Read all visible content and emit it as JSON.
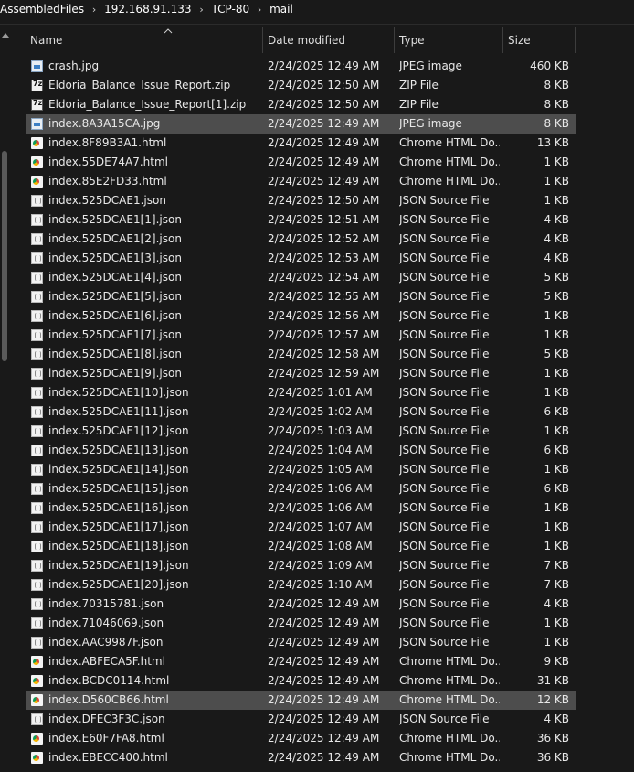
{
  "breadcrumb": {
    "items": [
      "AssembledFiles",
      "192.168.91.133",
      "TCP-80",
      "mail"
    ],
    "separator": "›"
  },
  "columns": {
    "name": "Name",
    "date": "Date modified",
    "type": "Type",
    "size": "Size",
    "sorted_column": "Name",
    "sort_direction": "ascending"
  },
  "files": [
    {
      "name": "crash.jpg",
      "date": "2/24/2025 12:49 AM",
      "type": "JPEG image",
      "size": "460 KB",
      "icon": "jpg-image-icon",
      "selected": false
    },
    {
      "name": "Eldoria_Balance_Issue_Report.zip",
      "date": "2/24/2025 12:50 AM",
      "type": "ZIP File",
      "size": "8 KB",
      "icon": "7zip-archive-icon",
      "selected": false
    },
    {
      "name": "Eldoria_Balance_Issue_Report[1].zip",
      "date": "2/24/2025 12:50 AM",
      "type": "ZIP File",
      "size": "8 KB",
      "icon": "7zip-archive-icon",
      "selected": false
    },
    {
      "name": "index.8A3A15CA.jpg",
      "date": "2/24/2025 12:49 AM",
      "type": "JPEG image",
      "size": "8 KB",
      "icon": "jpg-image-icon",
      "selected": true
    },
    {
      "name": "index.8F89B3A1.html",
      "date": "2/24/2025 12:49 AM",
      "type": "Chrome HTML Do...",
      "size": "13 KB",
      "icon": "chrome-html-icon",
      "selected": false
    },
    {
      "name": "index.55DE74A7.html",
      "date": "2/24/2025 12:49 AM",
      "type": "Chrome HTML Do...",
      "size": "1 KB",
      "icon": "chrome-html-icon",
      "selected": false
    },
    {
      "name": "index.85E2FD33.html",
      "date": "2/24/2025 12:49 AM",
      "type": "Chrome HTML Do...",
      "size": "1 KB",
      "icon": "chrome-html-icon",
      "selected": false
    },
    {
      "name": "index.525DCAE1.json",
      "date": "2/24/2025 12:50 AM",
      "type": "JSON Source File",
      "size": "1 KB",
      "icon": "json-file-icon",
      "selected": false
    },
    {
      "name": "index.525DCAE1[1].json",
      "date": "2/24/2025 12:51 AM",
      "type": "JSON Source File",
      "size": "4 KB",
      "icon": "json-file-icon",
      "selected": false
    },
    {
      "name": "index.525DCAE1[2].json",
      "date": "2/24/2025 12:52 AM",
      "type": "JSON Source File",
      "size": "4 KB",
      "icon": "json-file-icon",
      "selected": false
    },
    {
      "name": "index.525DCAE1[3].json",
      "date": "2/24/2025 12:53 AM",
      "type": "JSON Source File",
      "size": "4 KB",
      "icon": "json-file-icon",
      "selected": false
    },
    {
      "name": "index.525DCAE1[4].json",
      "date": "2/24/2025 12:54 AM",
      "type": "JSON Source File",
      "size": "5 KB",
      "icon": "json-file-icon",
      "selected": false
    },
    {
      "name": "index.525DCAE1[5].json",
      "date": "2/24/2025 12:55 AM",
      "type": "JSON Source File",
      "size": "5 KB",
      "icon": "json-file-icon",
      "selected": false
    },
    {
      "name": "index.525DCAE1[6].json",
      "date": "2/24/2025 12:56 AM",
      "type": "JSON Source File",
      "size": "1 KB",
      "icon": "json-file-icon",
      "selected": false
    },
    {
      "name": "index.525DCAE1[7].json",
      "date": "2/24/2025 12:57 AM",
      "type": "JSON Source File",
      "size": "1 KB",
      "icon": "json-file-icon",
      "selected": false
    },
    {
      "name": "index.525DCAE1[8].json",
      "date": "2/24/2025 12:58 AM",
      "type": "JSON Source File",
      "size": "5 KB",
      "icon": "json-file-icon",
      "selected": false
    },
    {
      "name": "index.525DCAE1[9].json",
      "date": "2/24/2025 12:59 AM",
      "type": "JSON Source File",
      "size": "1 KB",
      "icon": "json-file-icon",
      "selected": false
    },
    {
      "name": "index.525DCAE1[10].json",
      "date": "2/24/2025 1:01 AM",
      "type": "JSON Source File",
      "size": "1 KB",
      "icon": "json-file-icon",
      "selected": false
    },
    {
      "name": "index.525DCAE1[11].json",
      "date": "2/24/2025 1:02 AM",
      "type": "JSON Source File",
      "size": "6 KB",
      "icon": "json-file-icon",
      "selected": false
    },
    {
      "name": "index.525DCAE1[12].json",
      "date": "2/24/2025 1:03 AM",
      "type": "JSON Source File",
      "size": "1 KB",
      "icon": "json-file-icon",
      "selected": false
    },
    {
      "name": "index.525DCAE1[13].json",
      "date": "2/24/2025 1:04 AM",
      "type": "JSON Source File",
      "size": "6 KB",
      "icon": "json-file-icon",
      "selected": false
    },
    {
      "name": "index.525DCAE1[14].json",
      "date": "2/24/2025 1:05 AM",
      "type": "JSON Source File",
      "size": "1 KB",
      "icon": "json-file-icon",
      "selected": false
    },
    {
      "name": "index.525DCAE1[15].json",
      "date": "2/24/2025 1:06 AM",
      "type": "JSON Source File",
      "size": "6 KB",
      "icon": "json-file-icon",
      "selected": false
    },
    {
      "name": "index.525DCAE1[16].json",
      "date": "2/24/2025 1:06 AM",
      "type": "JSON Source File",
      "size": "1 KB",
      "icon": "json-file-icon",
      "selected": false
    },
    {
      "name": "index.525DCAE1[17].json",
      "date": "2/24/2025 1:07 AM",
      "type": "JSON Source File",
      "size": "1 KB",
      "icon": "json-file-icon",
      "selected": false
    },
    {
      "name": "index.525DCAE1[18].json",
      "date": "2/24/2025 1:08 AM",
      "type": "JSON Source File",
      "size": "1 KB",
      "icon": "json-file-icon",
      "selected": false
    },
    {
      "name": "index.525DCAE1[19].json",
      "date": "2/24/2025 1:09 AM",
      "type": "JSON Source File",
      "size": "7 KB",
      "icon": "json-file-icon",
      "selected": false
    },
    {
      "name": "index.525DCAE1[20].json",
      "date": "2/24/2025 1:10 AM",
      "type": "JSON Source File",
      "size": "7 KB",
      "icon": "json-file-icon",
      "selected": false
    },
    {
      "name": "index.70315781.json",
      "date": "2/24/2025 12:49 AM",
      "type": "JSON Source File",
      "size": "4 KB",
      "icon": "json-file-icon",
      "selected": false
    },
    {
      "name": "index.71046069.json",
      "date": "2/24/2025 12:49 AM",
      "type": "JSON Source File",
      "size": "1 KB",
      "icon": "json-file-icon",
      "selected": false
    },
    {
      "name": "index.AAC9987F.json",
      "date": "2/24/2025 12:49 AM",
      "type": "JSON Source File",
      "size": "1 KB",
      "icon": "json-file-icon",
      "selected": false
    },
    {
      "name": "index.ABFECA5F.html",
      "date": "2/24/2025 12:49 AM",
      "type": "Chrome HTML Do...",
      "size": "9 KB",
      "icon": "chrome-html-icon",
      "selected": false
    },
    {
      "name": "index.BCDC0114.html",
      "date": "2/24/2025 12:49 AM",
      "type": "Chrome HTML Do...",
      "size": "31 KB",
      "icon": "chrome-html-icon",
      "selected": false
    },
    {
      "name": "index.D560CB66.html",
      "date": "2/24/2025 12:49 AM",
      "type": "Chrome HTML Do...",
      "size": "12 KB",
      "icon": "chrome-html-icon",
      "selected": true
    },
    {
      "name": "index.DFEC3F3C.json",
      "date": "2/24/2025 12:49 AM",
      "type": "JSON Source File",
      "size": "4 KB",
      "icon": "json-file-icon",
      "selected": false
    },
    {
      "name": "index.E60F7FA8.html",
      "date": "2/24/2025 12:49 AM",
      "type": "Chrome HTML Do...",
      "size": "36 KB",
      "icon": "chrome-html-icon",
      "selected": false
    },
    {
      "name": "index.EBECC400.html",
      "date": "2/24/2025 12:49 AM",
      "type": "Chrome HTML Do...",
      "size": "36 KB",
      "icon": "chrome-html-icon",
      "selected": false
    }
  ],
  "colors": {
    "background": "#191919",
    "selection": "#4d4d4d",
    "text": "#e8e8e8"
  }
}
